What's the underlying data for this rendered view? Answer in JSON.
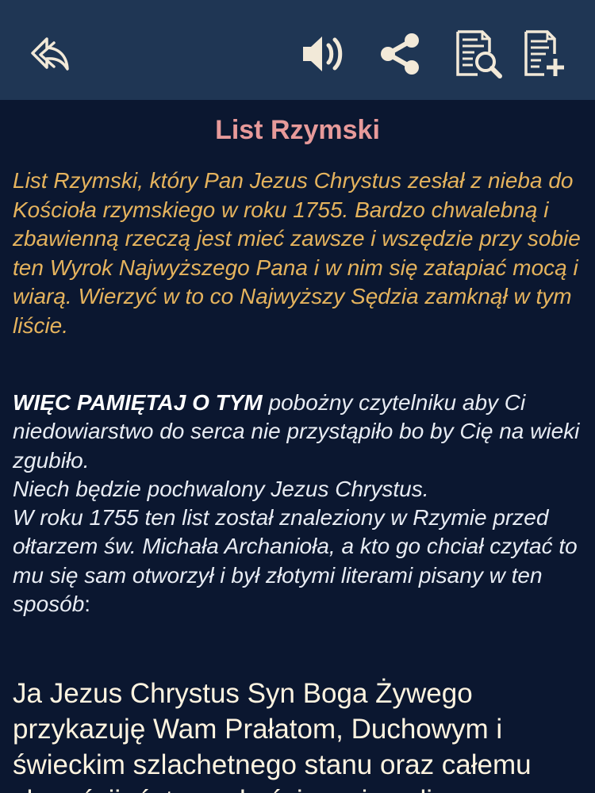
{
  "toolbar": {
    "icons": {
      "back": "reply-arrow-icon",
      "sound": "speaker-icon",
      "share": "share-icon",
      "search": "document-search-icon",
      "add": "document-add-icon"
    },
    "background_color": "#1f3654",
    "icon_color": "#f2e9d8"
  },
  "article": {
    "title": "List Rzymski",
    "intro": "List Rzymski, który Pan Jezus Chrystus zesłał z nieba do Kościoła rzymskiego w roku 1755. Bardzo chwalebną i zbawienną rzeczą jest mieć zawsze i wszędzie przy sobie ten Wyrok Najwyższego Pana i w nim się zatapiać mocą i wiarą. Wierzyć w to co Najwyższy Sędzia zamknął w tym liście.",
    "warning_lead": "WIĘC PAMIĘTAJ O TYM",
    "warning_body": " pobożny czytelniku aby Ci niedowiarstwo do serca nie przystąpiło bo by Cię na wieki zgubiło.",
    "praise": "Niech będzie pochwalony Jezus Chrystus.",
    "history": "W roku 1755 ten list został znaleziony w Rzymie przed ołtarzem św. Michała Archanioła, a kto go chciał czytać to mu się sam otworzył i był złotymi literami pisany w ten sposób",
    "history_end": ":",
    "letter_text": "Ja Jezus Chrystus Syn Boga Żywego przykazuję Wam Prałatom, Duchowym i świeckim szlachetnego stanu oraz całemu chrześcijaństwu, abyście uwierzyli"
  },
  "colors": {
    "background": "#0b1730",
    "title": "#e79a9a",
    "intro": "#e5b35d",
    "body": "#e8ecf3",
    "letter": "#fff4e0"
  }
}
